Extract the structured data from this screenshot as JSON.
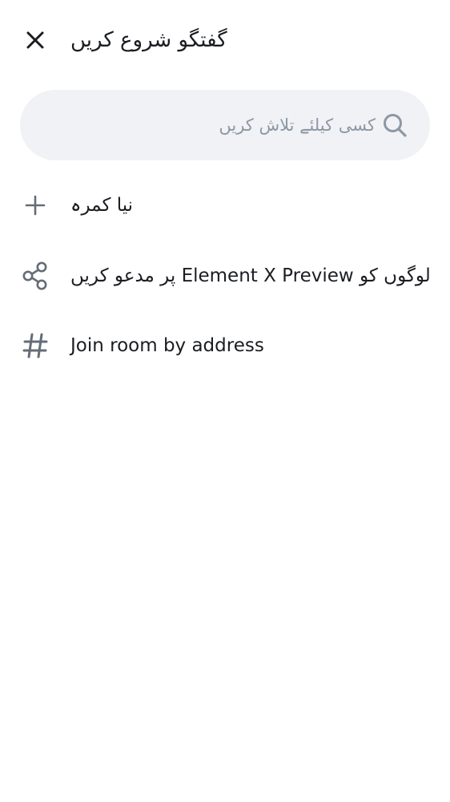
{
  "header": {
    "title": "گفتگو شروع کریں",
    "close_icon": "close-icon"
  },
  "search": {
    "placeholder": "کسی کیلئے تلاش کریں",
    "value": "",
    "icon": "search-icon"
  },
  "actions": [
    {
      "icon": "plus-icon",
      "label": "نیا کمرہ"
    },
    {
      "icon": "share-icon",
      "label": "لوگوں کو Element X Preview پر مدعو کریں"
    },
    {
      "icon": "hash-icon",
      "label": "Join room by address"
    }
  ],
  "colors": {
    "background": "#ffffff",
    "search_background": "#f0f2f5",
    "icon": "#656d77",
    "placeholder": "#8d97a5",
    "text": "#1b1d22"
  }
}
